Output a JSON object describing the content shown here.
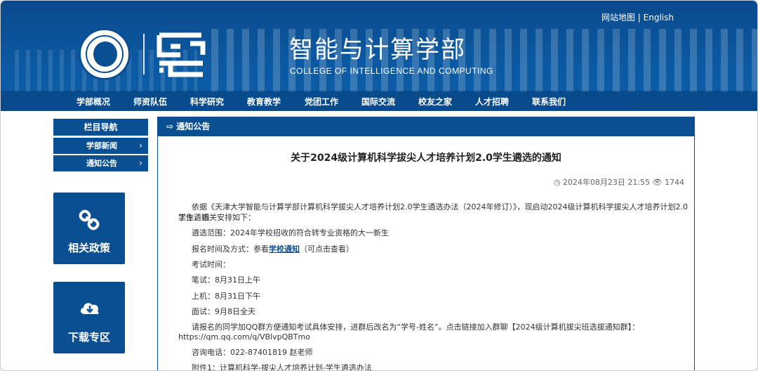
{
  "header": {
    "top_links": {
      "sitemap": "网站地图",
      "separator": " | ",
      "english": "English"
    },
    "college_cn": "智能与计算学部",
    "college_en": "COLLEGE OF INTELLIGENCE AND COMPUTING",
    "nav": [
      "学部概况",
      "师资队伍",
      "科学研究",
      "教育教学",
      "党团工作",
      "国际交流",
      "校友之家",
      "人才招聘",
      "联系我们"
    ]
  },
  "sidebar": {
    "title": "栏目导航",
    "items": [
      {
        "label": "学部新闻"
      },
      {
        "label": "通知公告"
      }
    ],
    "tiles": [
      {
        "label": "相关政策",
        "icon": "link-icon"
      },
      {
        "label": "下载专区",
        "icon": "cloud-download-icon"
      }
    ]
  },
  "article": {
    "section": "通知公告",
    "title": "关于2024级计算机科学拔尖人才培养计划2.0学生遴选的通知",
    "date": "2024年08月23日 21:55",
    "views": "1744",
    "paragraphs": {
      "p1_line1": "依据《天津大学智能与计算学部计算机科学拔尖人才培养计划2.0学生遴选办法（2024年修订）》，现启动2024级计算机科学拔尖人才培养计划2.0学生遴选",
      "p1_line2": "工作，相关安排如下：",
      "scope": "遴选范围：2024年学校招收的符合转专业资格的大一新生",
      "signup_prefix": "报名时间及方式：参看",
      "signup_link": "学校通知",
      "signup_suffix": "（可点击查看）",
      "exam_time": "考试时间：",
      "written": "笔试：8月31日上午",
      "machine": "上机：8月31日下午",
      "interview": "面试：9月8日全天",
      "qq_line1": "请报名的同学加QQ群方便通知考试具体安排，进群后改名为“学号-姓名”。点击链接加入群聊【2024级计算机拔尖班选拔通知群】：",
      "qq_line2": "https://qm.qq.com/q/VBlvpQBTmo",
      "contact": "咨询电话：022-87401819 赵老师",
      "attachment": "附件1：计算机科学-拔尖人才培养计划-学生遴选办法"
    }
  },
  "colors": {
    "brand": "#0b4f93",
    "link": "#0b4f93"
  }
}
